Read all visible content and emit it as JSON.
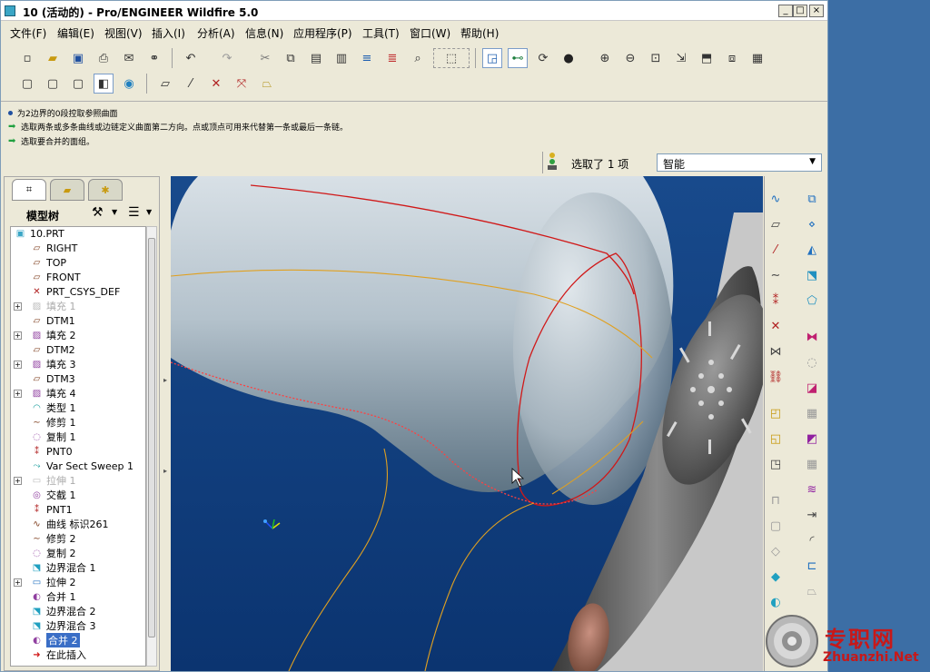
{
  "window": {
    "title": "10 (活动的) - Pro/ENGINEER Wildfire 5.0",
    "controls": [
      "_",
      "□",
      "×"
    ]
  },
  "menu": [
    "文件(F)",
    "编辑(E)",
    "视图(V)",
    "插入(I)",
    "分析(A)",
    "信息(N)",
    "应用程序(P)",
    "工具(T)",
    "窗口(W)",
    "帮助(H)"
  ],
  "messages": [
    {
      "text": "为2边界的0段控取参照曲面",
      "kind": "info"
    },
    {
      "text": "选取两条或多条曲线或边链定义曲面第二方向。点或顶点可用来代替第一条或最后一条链。",
      "kind": "prompt"
    },
    {
      "text": "选取要合并的面组。",
      "kind": "prompt"
    }
  ],
  "status": {
    "selected_text": "选取了 1 项",
    "filter_value": "智能"
  },
  "left_pane": {
    "tabs": [
      "model-tree-tab",
      "layer-tab",
      "favorites-tab"
    ],
    "header_label": "模型树",
    "tree": [
      {
        "label": "10.PRT",
        "icon": "part-icon",
        "expandable": false,
        "dim": false,
        "selected": false
      },
      {
        "label": "RIGHT",
        "icon": "datum-plane-icon",
        "expandable": false,
        "dim": false,
        "selected": false
      },
      {
        "label": "TOP",
        "icon": "datum-plane-icon",
        "expandable": false,
        "dim": false,
        "selected": false
      },
      {
        "label": "FRONT",
        "icon": "datum-plane-icon",
        "expandable": false,
        "dim": false,
        "selected": false
      },
      {
        "label": "PRT_CSYS_DEF",
        "icon": "csys-icon",
        "expandable": false,
        "dim": false,
        "selected": false
      },
      {
        "label": "填充 1",
        "icon": "fill-icon",
        "expandable": true,
        "dim": true,
        "selected": false
      },
      {
        "label": "DTM1",
        "icon": "datum-plane-icon",
        "expandable": false,
        "dim": false,
        "selected": false
      },
      {
        "label": "填充 2",
        "icon": "fill-icon",
        "expandable": true,
        "dim": false,
        "selected": false
      },
      {
        "label": "DTM2",
        "icon": "datum-plane-icon",
        "expandable": false,
        "dim": false,
        "selected": false
      },
      {
        "label": "填充 3",
        "icon": "fill-icon",
        "expandable": true,
        "dim": false,
        "selected": false
      },
      {
        "label": "DTM3",
        "icon": "datum-plane-icon",
        "expandable": false,
        "dim": false,
        "selected": false
      },
      {
        "label": "填充 4",
        "icon": "fill-icon",
        "expandable": true,
        "dim": false,
        "selected": false
      },
      {
        "label": "类型 1",
        "icon": "style-icon",
        "expandable": false,
        "dim": false,
        "selected": false
      },
      {
        "label": "修剪 1",
        "icon": "trim-icon",
        "expandable": false,
        "dim": false,
        "selected": false
      },
      {
        "label": "复制 1",
        "icon": "copy-icon",
        "expandable": false,
        "dim": false,
        "selected": false
      },
      {
        "label": "PNT0",
        "icon": "point-icon",
        "expandable": false,
        "dim": false,
        "selected": false
      },
      {
        "label": "Var Sect Sweep 1",
        "icon": "sweep-icon",
        "expandable": false,
        "dim": false,
        "selected": false
      },
      {
        "label": "拉伸 1",
        "icon": "extrude-icon",
        "expandable": true,
        "dim": true,
        "selected": false
      },
      {
        "label": "交截 1",
        "icon": "intersect-icon",
        "expandable": false,
        "dim": false,
        "selected": false
      },
      {
        "label": "PNT1",
        "icon": "point-icon",
        "expandable": false,
        "dim": false,
        "selected": false
      },
      {
        "label": "曲线 标识261",
        "icon": "curve-icon",
        "expandable": false,
        "dim": false,
        "selected": false
      },
      {
        "label": "修剪 2",
        "icon": "trim-icon",
        "expandable": false,
        "dim": false,
        "selected": false
      },
      {
        "label": "复制 2",
        "icon": "copy-icon",
        "expandable": false,
        "dim": false,
        "selected": false
      },
      {
        "label": "边界混合 1",
        "icon": "blend-icon",
        "expandable": false,
        "dim": false,
        "selected": false
      },
      {
        "label": "拉伸 2",
        "icon": "extrude-icon",
        "expandable": true,
        "dim": false,
        "selected": false
      },
      {
        "label": "合并 1",
        "icon": "merge-icon",
        "expandable": false,
        "dim": false,
        "selected": false
      },
      {
        "label": "边界混合 2",
        "icon": "blend-icon",
        "expandable": false,
        "dim": false,
        "selected": false
      },
      {
        "label": "边界混合 3",
        "icon": "blend-icon",
        "expandable": false,
        "dim": false,
        "selected": false
      },
      {
        "label": "合并 2",
        "icon": "merge-icon",
        "expandable": false,
        "dim": false,
        "selected": true
      },
      {
        "label": "在此插入",
        "icon": "insert-here-icon",
        "expandable": false,
        "dim": false,
        "selected": false
      }
    ]
  },
  "watermark": {
    "text_cn": "专职网",
    "text_en": "Zhuanzhi.Net"
  },
  "colors": {
    "accent": "#3a6ec6",
    "viewport_top": "#184a8c",
    "viewport_bottom": "#0b3470",
    "curve_red": "#d01818",
    "curve_yellow": "#e0a020",
    "watermark_red": "#c81818"
  }
}
